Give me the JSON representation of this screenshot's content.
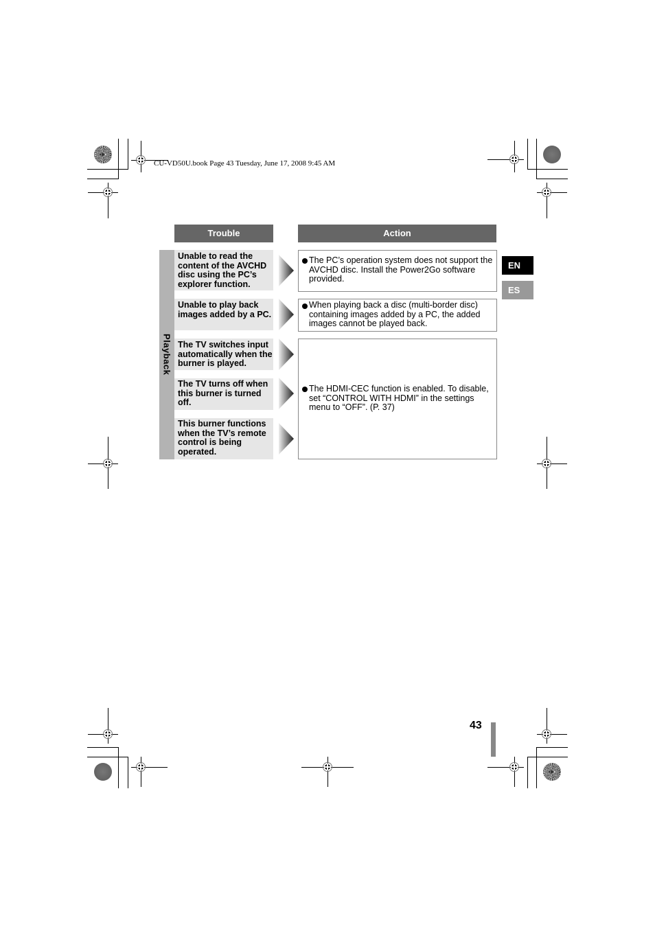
{
  "header": {
    "book_line": "CU-VD50U.book  Page 43  Tuesday, June 17, 2008  9:45 AM"
  },
  "table": {
    "column_headers": {
      "trouble": "Trouble",
      "action": "Action"
    },
    "section_label": "Playback",
    "troubles": [
      "Unable to read the content of the AVCHD disc using the PC’s explorer function.",
      "Unable to play back images added by a PC.",
      "The TV switches input automatically when the burner is played.",
      "The TV turns off when this burner is turned off.",
      "This burner functions when the TV’s remote control is being operated."
    ],
    "actions": [
      "The PC’s operation system does not support the AVCHD disc. Install the Power2Go software provided.",
      "When playing back a disc (multi-border disc) containing images added by a PC, the added images cannot be played back.",
      "The HDMI-CEC function is enabled. To disable, set “CONTROL WITH HDMI” in the settings menu to “OFF”. (P. 37)"
    ]
  },
  "language_tabs": [
    {
      "label": "EN",
      "active": true,
      "color": "#000000"
    },
    {
      "label": "ES",
      "active": false,
      "color": "#999999"
    }
  ],
  "footer": {
    "page_number": "43"
  },
  "colors": {
    "header_bg": "#666666",
    "trouble_bg": "#e6e6e6",
    "side_tab_bg": "#b3b3b3",
    "page_bar": "#888888"
  }
}
